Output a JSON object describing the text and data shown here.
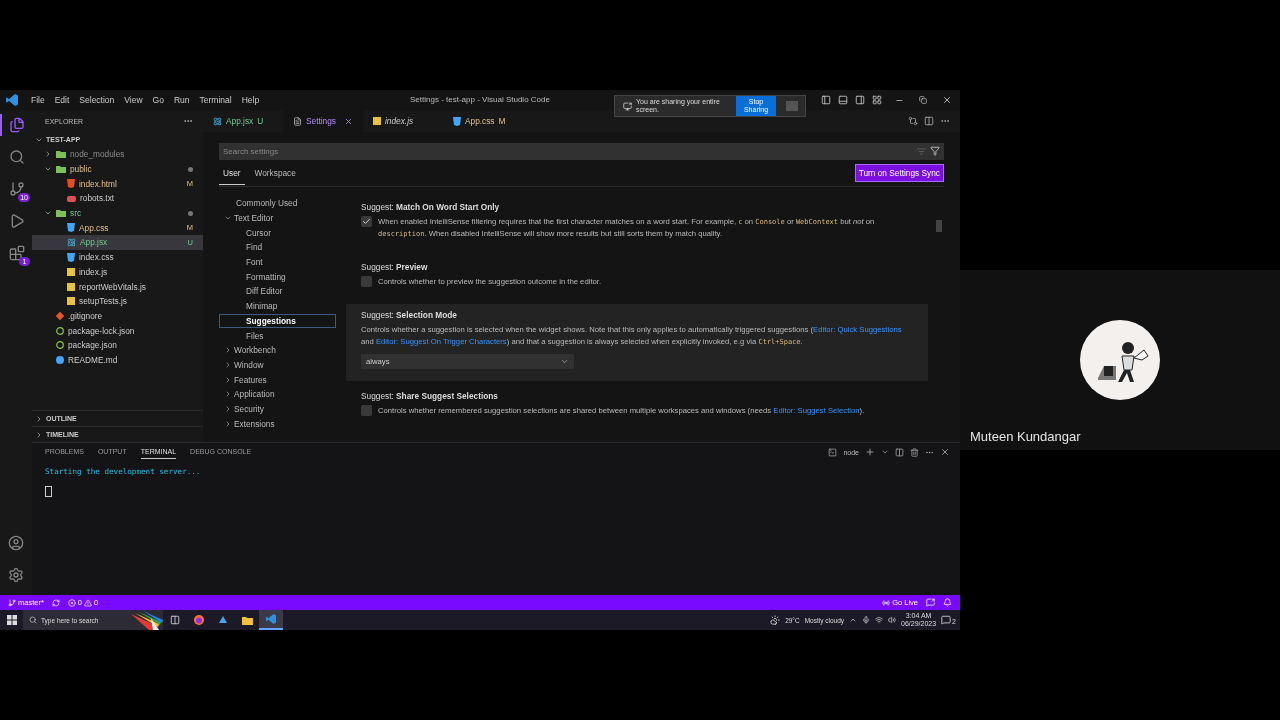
{
  "menu": [
    "File",
    "Edit",
    "Selection",
    "View",
    "Go",
    "Run",
    "Terminal",
    "Help"
  ],
  "window_title": "Settings - test-app - Visual Studio Code",
  "share_bar": {
    "message": "You are sharing your entire screen.",
    "button": "Stop Sharing"
  },
  "activity_bar": [
    {
      "kind": "explorer",
      "selected": true
    },
    {
      "kind": "search",
      "selected": false
    },
    {
      "kind": "source_control",
      "selected": false,
      "badge": "10"
    },
    {
      "kind": "run",
      "selected": false
    },
    {
      "kind": "extensions",
      "selected": false,
      "badge": "1"
    }
  ],
  "explorer": {
    "title": "EXPLORER",
    "project": "TEST-APP",
    "tree": [
      {
        "label": "node_modules",
        "kind": "folder",
        "ignored": true,
        "modified": false,
        "untracked": false,
        "expanded": false,
        "selected": false
      },
      {
        "label": "public",
        "kind": "folder",
        "ignored": false,
        "modified": true,
        "untracked": false,
        "expanded": true,
        "selected": false,
        "children": [
          {
            "label": "index.html",
            "kind": "html",
            "ignored": false,
            "modified": true,
            "untracked": false,
            "badge": "M",
            "selected": false
          },
          {
            "label": "robots.txt",
            "kind": "robot",
            "ignored": false,
            "modified": false,
            "untracked": false,
            "selected": false
          }
        ]
      },
      {
        "label": "src",
        "kind": "folder",
        "ignored": false,
        "modified": false,
        "untracked": true,
        "expanded": true,
        "selected": false,
        "children": [
          {
            "label": "App.css",
            "kind": "css",
            "ignored": false,
            "modified": true,
            "untracked": false,
            "badge": "M",
            "selected": false
          },
          {
            "label": "App.jsx",
            "kind": "react",
            "ignored": false,
            "modified": false,
            "untracked": true,
            "badge": "U",
            "selected": true
          },
          {
            "label": "index.css",
            "kind": "css",
            "ignored": false,
            "modified": false,
            "untracked": false,
            "selected": false
          },
          {
            "label": "index.js",
            "kind": "js",
            "ignored": false,
            "modified": false,
            "untracked": false,
            "selected": false
          },
          {
            "label": "reportWebVitals.js",
            "kind": "js",
            "ignored": false,
            "modified": false,
            "untracked": false,
            "selected": false
          },
          {
            "label": "setupTests.js",
            "kind": "js",
            "ignored": false,
            "modified": false,
            "untracked": false,
            "selected": false
          }
        ]
      },
      {
        "label": ".gitignore",
        "kind": "git",
        "ignored": false,
        "modified": false,
        "untracked": false,
        "selected": false
      },
      {
        "label": "package-lock.json",
        "kind": "json",
        "ignored": false,
        "modified": false,
        "untracked": false,
        "selected": false
      },
      {
        "label": "package.json",
        "kind": "json",
        "ignored": false,
        "modified": false,
        "untracked": false,
        "selected": false
      },
      {
        "label": "README.md",
        "kind": "info",
        "ignored": false,
        "modified": false,
        "untracked": false,
        "selected": false
      }
    ],
    "sections": [
      "OUTLINE",
      "TIMELINE"
    ]
  },
  "tabs": [
    {
      "label": "App.jsx",
      "kind": "react",
      "modified": false,
      "untracked": true,
      "badge": "U",
      "preview": false,
      "selected": false
    },
    {
      "label": "Settings",
      "kind": "settings",
      "modified": false,
      "untracked": false,
      "preview": false,
      "selected": true
    },
    {
      "label": "index.js",
      "kind": "js",
      "modified": false,
      "untracked": false,
      "preview": true,
      "selected": false
    },
    {
      "label": "App.css",
      "kind": "css",
      "modified": true,
      "untracked": false,
      "badge": "M",
      "preview": false,
      "selected": false
    }
  ],
  "settings": {
    "search_placeholder": "Search settings",
    "scopes": [
      {
        "label": "User",
        "selected": true
      },
      {
        "label": "Workspace",
        "selected": false
      }
    ],
    "sync_button": "Turn on Settings Sync",
    "toc": [
      {
        "label": "Commonly Used",
        "selected": false
      },
      {
        "label": "Text Editor",
        "expanded": true,
        "selected": false,
        "children": [
          {
            "label": "Cursor",
            "selected": false
          },
          {
            "label": "Find",
            "selected": false
          },
          {
            "label": "Font",
            "selected": false
          },
          {
            "label": "Formatting",
            "selected": false
          },
          {
            "label": "Diff Editor",
            "selected": false
          },
          {
            "label": "Minimap",
            "selected": false
          },
          {
            "label": "Suggestions",
            "selected": true
          },
          {
            "label": "Files",
            "selected": false
          }
        ]
      },
      {
        "label": "Workbench",
        "expanded": false,
        "selected": false
      },
      {
        "label": "Window",
        "expanded": false,
        "selected": false
      },
      {
        "label": "Features",
        "expanded": false,
        "selected": false
      },
      {
        "label": "Application",
        "expanded": false,
        "selected": false
      },
      {
        "label": "Security",
        "expanded": false,
        "selected": false
      },
      {
        "label": "Extensions",
        "expanded": false,
        "selected": false
      }
    ],
    "items": [
      {
        "kind": "checkbox",
        "title": "Suggest: **Match On Word Start Only**",
        "checked": true,
        "highlighted": false,
        "description": [
          {
            "kind": "text",
            "text": "When enabled IntelliSense filtering requires that the first character matches on a word start. For example, "
          },
          {
            "kind": "code",
            "text": "c"
          },
          {
            "kind": "text",
            "text": " on "
          },
          {
            "kind": "code",
            "text": "Console"
          },
          {
            "kind": "text",
            "text": " or "
          },
          {
            "kind": "code",
            "text": "WebContext"
          },
          {
            "kind": "text",
            "text": " but "
          },
          {
            "kind": "em",
            "text": "not"
          },
          {
            "kind": "text",
            "text": " on "
          },
          {
            "kind": "code",
            "text": "description"
          },
          {
            "kind": "text",
            "text": ". When disabled IntelliSense will show more results but still sorts them by match quality."
          }
        ]
      },
      {
        "kind": "checkbox",
        "title": "Suggest: **Preview**",
        "checked": false,
        "highlighted": false,
        "description": [
          {
            "kind": "text",
            "text": "Controls whether to preview the suggestion outcome in the editor."
          }
        ]
      },
      {
        "kind": "dropdown",
        "title": "Suggest: **Selection Mode**",
        "value": "always",
        "highlighted": true,
        "description": [
          {
            "kind": "text",
            "text": "Controls whether a suggestion is selected when the widget shows. Note that this only applies to automatically triggered suggestions ("
          },
          {
            "kind": "link",
            "text": "Editor: Quick Suggestions"
          },
          {
            "kind": "text",
            "text": " and "
          },
          {
            "kind": "link",
            "text": "Editor: Suggest On Trigger Characters"
          },
          {
            "kind": "text",
            "text": ") and that a suggestion is always selected when explicitly invoked, e.g via "
          },
          {
            "kind": "code",
            "text": "Ctrl+Space"
          },
          {
            "kind": "text",
            "text": "."
          }
        ]
      },
      {
        "kind": "checkbox",
        "title": "Suggest: **Share Suggest Selections**",
        "checked": false,
        "highlighted": false,
        "description": [
          {
            "kind": "text",
            "text": "Controls whether remembered suggestion selections are shared between multiple workspaces and windows (needs "
          },
          {
            "kind": "link",
            "text": "Editor: Suggest Selection"
          },
          {
            "kind": "text",
            "text": ")."
          }
        ]
      }
    ]
  },
  "panel": {
    "tabs": [
      {
        "label": "PROBLEMS",
        "selected": false
      },
      {
        "label": "OUTPUT",
        "selected": false
      },
      {
        "label": "TERMINAL",
        "selected": true
      },
      {
        "label": "DEBUG CONSOLE",
        "selected": false
      }
    ],
    "shell": "node",
    "lines": [
      "Starting the development server..."
    ]
  },
  "status_bar": {
    "branch": "master*",
    "errors": "0",
    "warnings": "0",
    "go_live": "Go Live"
  },
  "taskbar": {
    "search_placeholder": "Type here to search",
    "temperature": "29°C",
    "weather": "Mostly cloudy",
    "time": "3:04 AM",
    "date": "06/29/2023",
    "notifications": "2"
  },
  "participant": {
    "name": "Muteen Kundangar"
  }
}
